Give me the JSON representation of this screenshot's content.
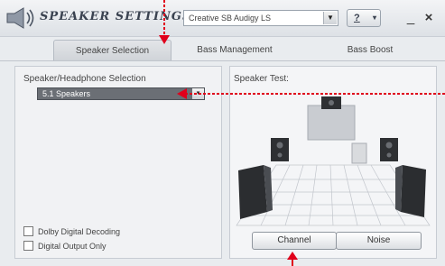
{
  "window": {
    "title": "SPEAKER SETTINGS",
    "device": "Creative SB Audigy LS",
    "help_label": "?",
    "help_arrow": "▾",
    "minimize": "_",
    "close": "×"
  },
  "tabs": [
    {
      "label": "Speaker Selection",
      "active": true
    },
    {
      "label": "Bass Management",
      "active": false
    },
    {
      "label": "Bass Boost",
      "active": false
    }
  ],
  "left": {
    "group_label": "Speaker/Headphone Selection",
    "speaker_config": "5.1 Speakers",
    "dropdown_arrow": "▾",
    "checkboxes": [
      {
        "label": "Dolby Digital Decoding",
        "checked": false
      },
      {
        "label": "Digital Output Only",
        "checked": false
      }
    ]
  },
  "right": {
    "test_label": "Speaker Test:",
    "channel_button": "Channel",
    "noise_button": "Noise"
  },
  "colors": {
    "annotation": "#e0001b",
    "panel_bg": "#f4f5f7",
    "selection_bg": "#6b6f75"
  }
}
